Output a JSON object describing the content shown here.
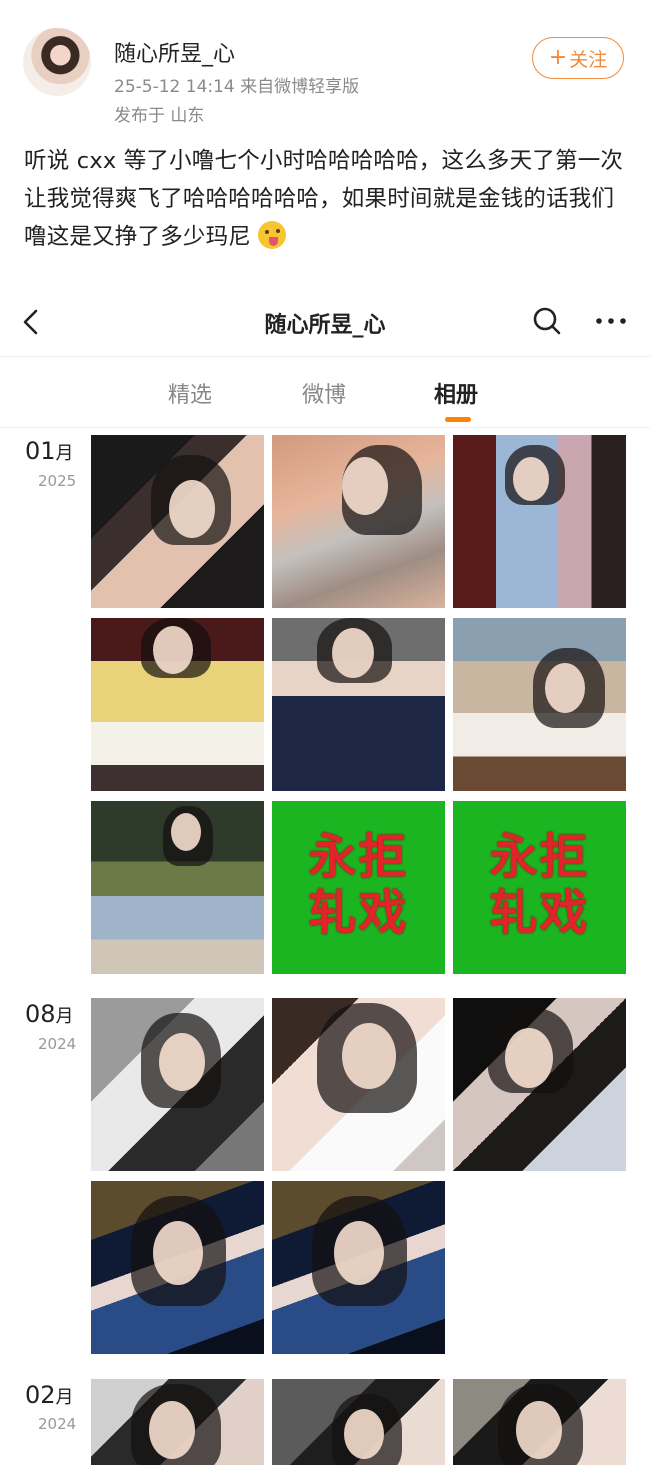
{
  "post": {
    "username": "随心所昱_心",
    "meta": "25-5-12 14:14  来自微博轻享版",
    "location": "发布于 山东",
    "follow_label": "关注",
    "follow_plus": "+",
    "text": "听说 cxx 等了小噜七个小时哈哈哈哈哈，这么多天了第一次让我觉得爽飞了哈哈哈哈哈哈，如果时间就是金钱的话我们噜这是又挣了多少玛尼",
    "emoji": "tongue-out-emoji"
  },
  "topbar": {
    "title": "随心所昱_心",
    "back_icon": "chevron-left-icon",
    "search_icon": "search-icon",
    "more_icon": "more-dots-icon"
  },
  "tabs": [
    {
      "label": "精选"
    },
    {
      "label": "微博"
    },
    {
      "label": "相册",
      "active": true
    }
  ],
  "album": {
    "accent": "#ff8200",
    "sections": [
      {
        "month": "01",
        "month_suffix": "月",
        "year": "2025"
      },
      {
        "month": "08",
        "month_suffix": "月",
        "year": "2024"
      },
      {
        "month": "02",
        "month_suffix": "月",
        "year": "2024"
      }
    ],
    "green_card_text_line1": "永拒",
    "green_card_text_line2": "轧戏",
    "green_card_bg": "#1bb522",
    "green_card_text_color": "#e0242a"
  }
}
